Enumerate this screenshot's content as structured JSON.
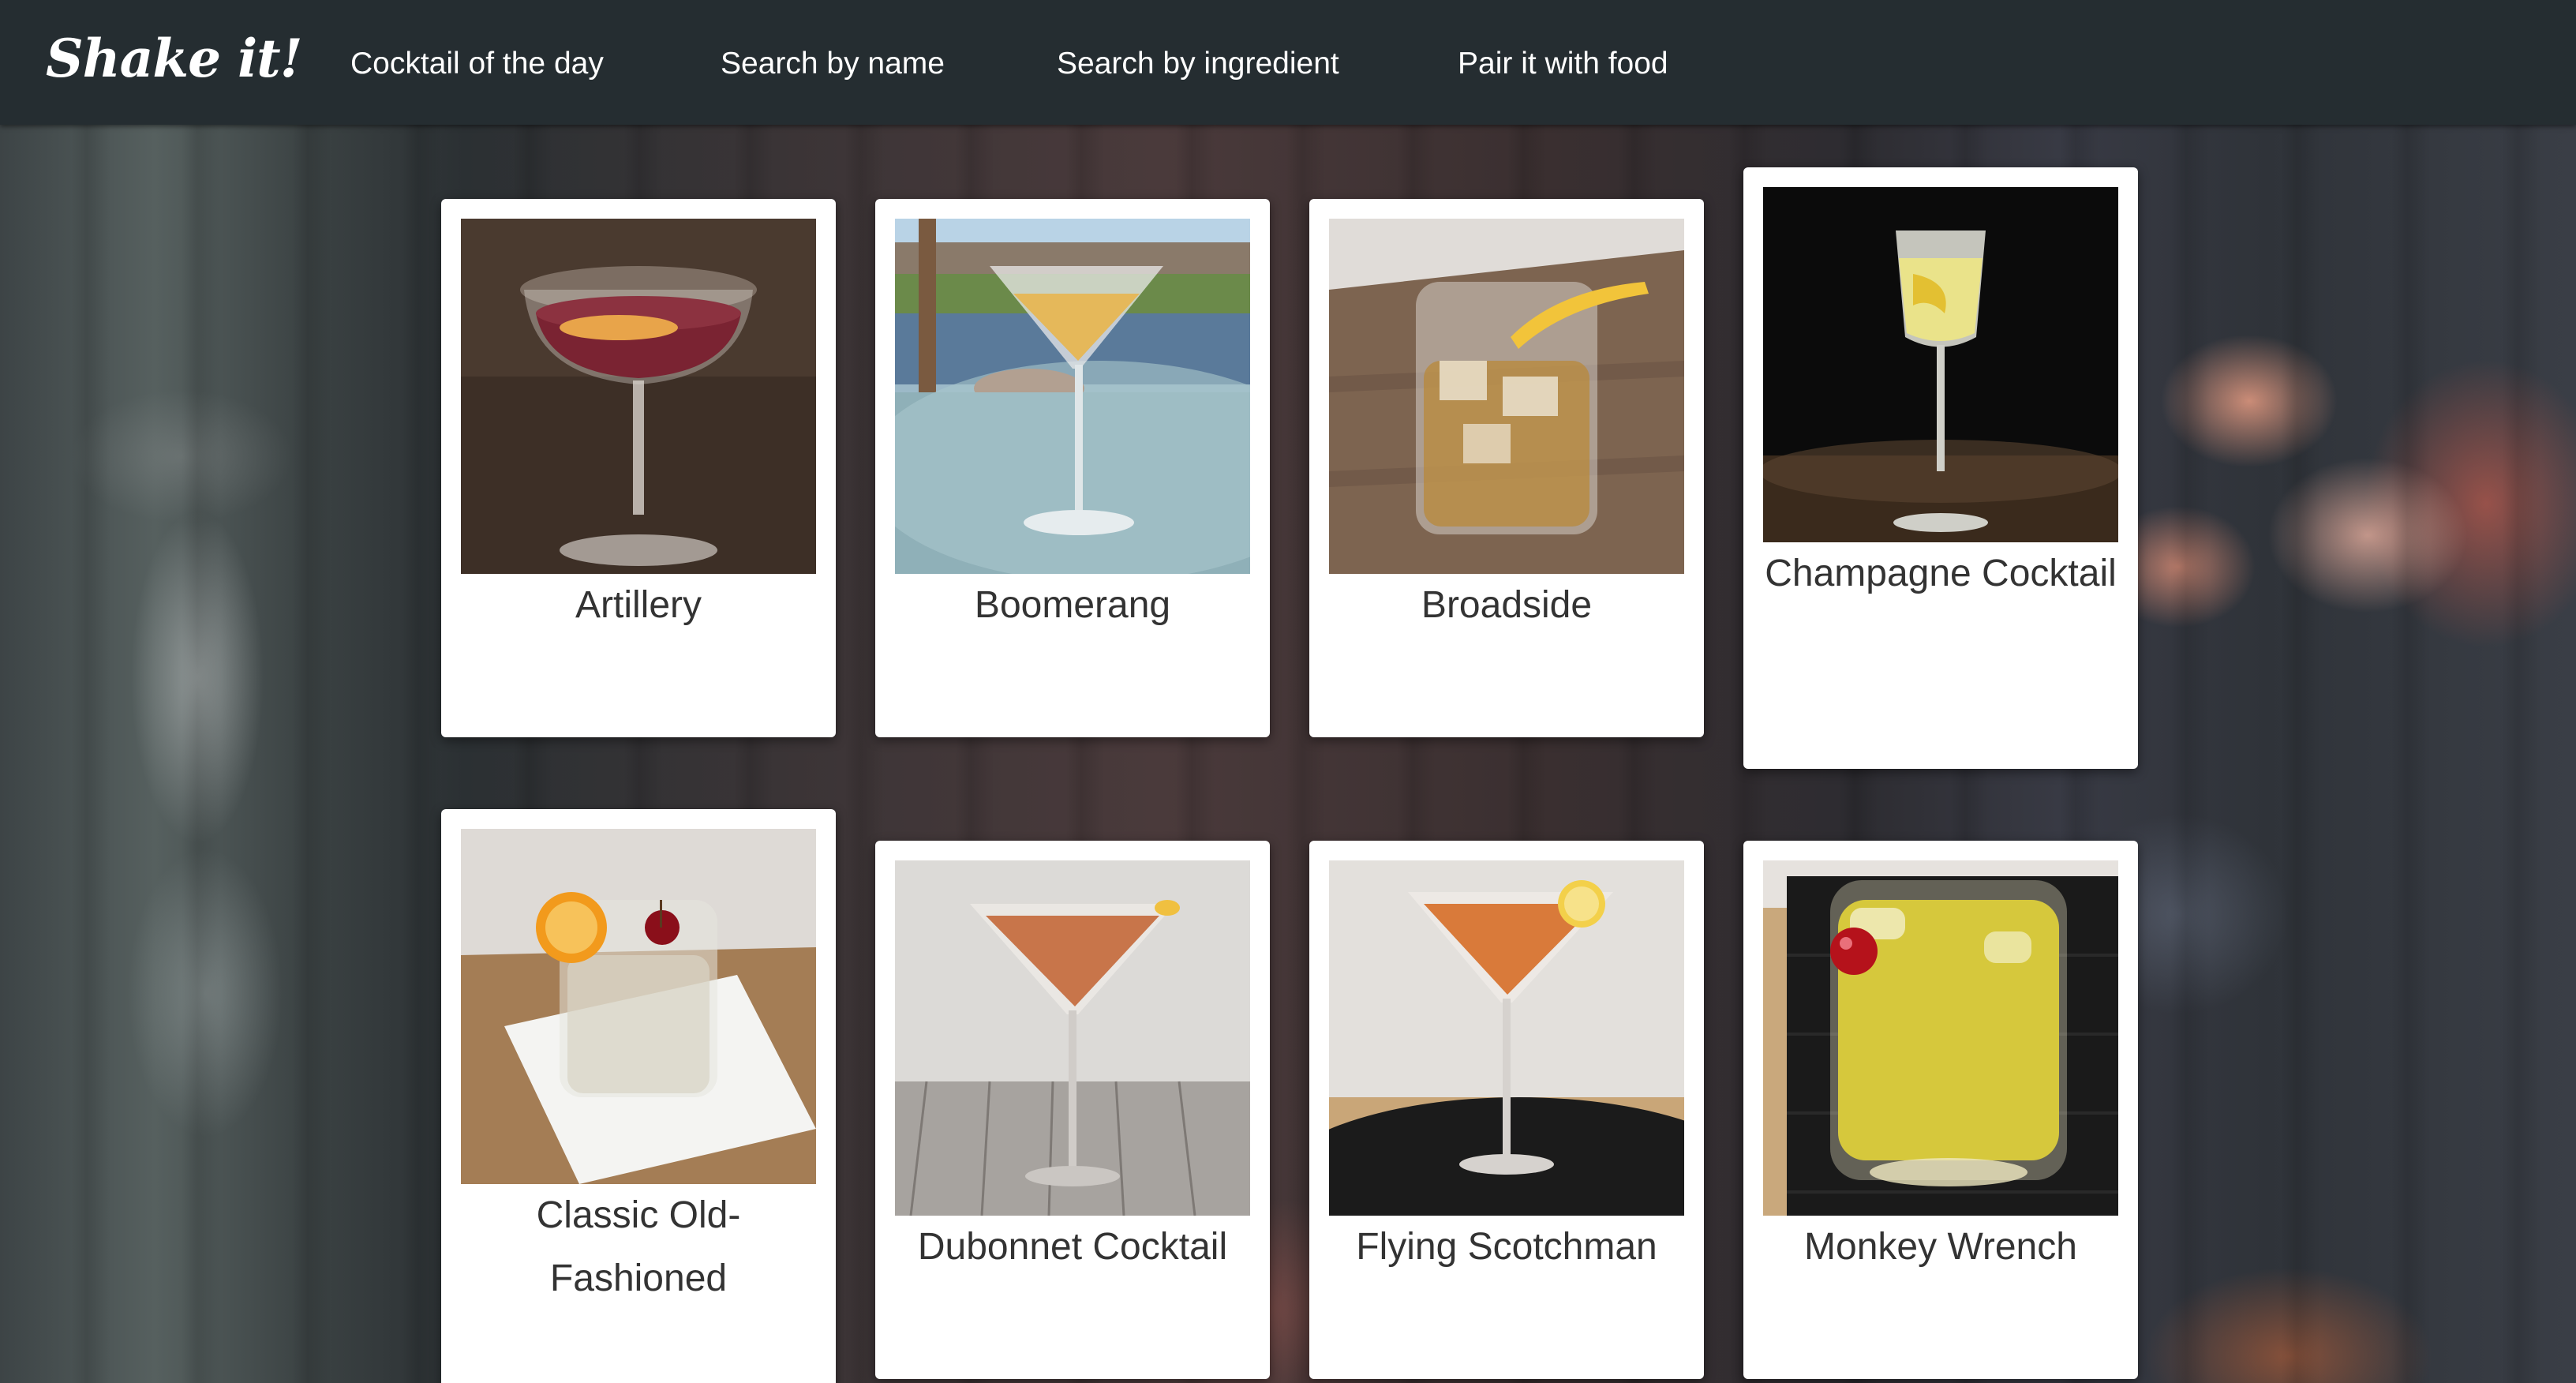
{
  "navbar": {
    "brand": "Shake it!",
    "links": [
      {
        "label": "Cocktail of the day"
      },
      {
        "label": "Search by name"
      },
      {
        "label": "Search by ingredient"
      },
      {
        "label": "Pair it with food"
      }
    ]
  },
  "cocktails": [
    {
      "name": "Artillery",
      "image_icon": "coupe-glass-red-drink"
    },
    {
      "name": "Boomerang",
      "image_icon": "martini-glass-outdoor"
    },
    {
      "name": "Broadside",
      "image_icon": "rocks-glass-lemon-twist"
    },
    {
      "name": "Champagne Cocktail",
      "image_icon": "champagne-flute-lemon"
    },
    {
      "name": "Classic Old-Fashioned",
      "image_icon": "rocks-glass-orange-cherry"
    },
    {
      "name": "Dubonnet Cocktail",
      "image_icon": "martini-glass-orange-drink"
    },
    {
      "name": "Flying Scotchman",
      "image_icon": "martini-glass-lemon-wheel"
    },
    {
      "name": "Monkey Wrench",
      "image_icon": "highball-yellow-cherry"
    }
  ],
  "colors": {
    "navbar": "#252d31",
    "card": "#ffffff",
    "card_text": "#333333",
    "nav_text": "#ffffff"
  }
}
